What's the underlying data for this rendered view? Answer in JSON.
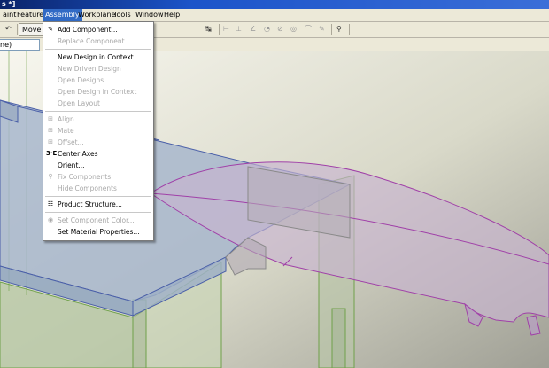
{
  "window": {
    "title_fragment": "s *]"
  },
  "menubar": [
    {
      "id": "paint",
      "label": "aint"
    },
    {
      "id": "feature",
      "label": "Feature"
    },
    {
      "id": "assembly",
      "label": "Assembly",
      "active": true
    },
    {
      "id": "workplane",
      "label": "Workplane"
    },
    {
      "id": "tools",
      "label": "Tools"
    },
    {
      "id": "window",
      "label": "Window"
    },
    {
      "id": "help",
      "label": "Help"
    }
  ],
  "toolbar": {
    "move_label": "Move C"
  },
  "filter": {
    "value": "ne)"
  },
  "assembly_menu": [
    {
      "label": "Add Component...",
      "icon": "add-component-icon",
      "enabled": true
    },
    {
      "label": "Replace Component...",
      "enabled": false
    },
    {
      "separator": true
    },
    {
      "label": "New Design in Context",
      "enabled": true
    },
    {
      "label": "New Driven Design",
      "enabled": false
    },
    {
      "label": "Open Designs",
      "enabled": false
    },
    {
      "label": "Open Design in Context",
      "enabled": false
    },
    {
      "label": "Open Layout",
      "enabled": false
    },
    {
      "separator": true
    },
    {
      "label": "Align",
      "icon": "align-icon",
      "enabled": false
    },
    {
      "label": "Mate",
      "icon": "mate-icon",
      "enabled": false
    },
    {
      "label": "Offset...",
      "icon": "offset-icon",
      "enabled": false
    },
    {
      "label": "Center Axes",
      "icon": "center-axes-icon",
      "enabled": true
    },
    {
      "label": "Orient...",
      "enabled": true
    },
    {
      "label": "Fix Components",
      "icon": "fix-components-icon",
      "enabled": false
    },
    {
      "label": "Hide Components",
      "enabled": false
    },
    {
      "separator": true
    },
    {
      "label": "Product Structure...",
      "icon": "product-structure-icon",
      "enabled": true
    },
    {
      "separator": true
    },
    {
      "label": "Set Component Color...",
      "icon": "color-icon",
      "enabled": false
    },
    {
      "label": "Set Material Properties...",
      "enabled": true
    }
  ],
  "colors": {
    "menu_highlight": "#316ac5",
    "titlebar": "#0a246a",
    "part_blue": "#4a5fa8",
    "part_green": "#6fa04a",
    "part_purple": "#a040a8"
  }
}
